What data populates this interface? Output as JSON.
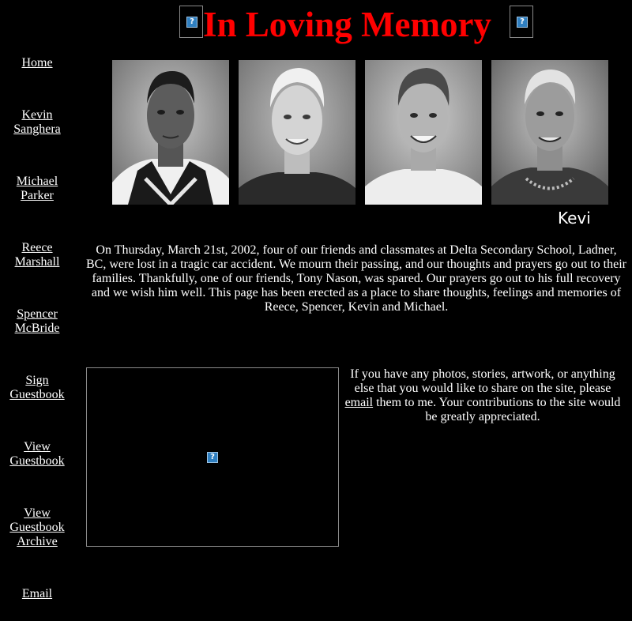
{
  "page": {
    "title": "In Loving Memory",
    "title_color": "#ff0000",
    "background_color": "#000000"
  },
  "nav": [
    {
      "label": "Home"
    },
    {
      "label": "Kevin Sanghera"
    },
    {
      "label": "Michael Parker"
    },
    {
      "label": "Reece Marshall"
    },
    {
      "label": "Spencer McBride"
    },
    {
      "label": "Sign Guestbook"
    },
    {
      "label": "View Guestbook"
    },
    {
      "label": "View Guestbook Archive"
    },
    {
      "label": "Email"
    }
  ],
  "photos": [
    "portrait-photo",
    "portrait-photo",
    "portrait-photo",
    "portrait-photo"
  ],
  "scrolling_text": "Kevi",
  "intro_text": "On Thursday, March 21st, 2002, four of our friends and classmates at Delta Secondary School, Ladner, BC,  were lost in a tragic car accident. We mourn their passing, and our thoughts and prayers go out to their families. Thankfully, one of our friends, Tony Nason, was spared. Our prayers go out to his full recovery and we wish him well. This page has been erected as a place to share thoughts, feelings and memories of Reece, Spencer, Kevin and Michael.",
  "share": {
    "before": "If you have any photos, stories, artwork, or anything else that you would like to share on the site, please ",
    "link": "email",
    "after": " them to me. Your contributions to the site would be greatly appreciated."
  },
  "icons": {
    "broken_image": "broken-image-icon"
  }
}
